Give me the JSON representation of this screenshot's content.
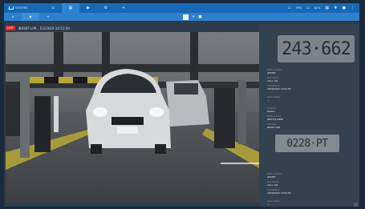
{
  "brand": {
    "name": "VIVOTEK"
  },
  "top_tabs": [
    {
      "icon": "home-icon",
      "glyph": "⌂",
      "active": false
    },
    {
      "icon": "liveview-icon",
      "glyph": "▦",
      "active": true
    },
    {
      "icon": "playback-icon",
      "glyph": "▶",
      "active": false
    },
    {
      "icon": "settings-icon",
      "glyph": "⚙",
      "active": false
    },
    {
      "icon": "add-icon",
      "glyph": "+",
      "active": false
    }
  ],
  "status": {
    "cpu": "39%",
    "mem": "62%"
  },
  "camera": {
    "live_label": "LIVE",
    "name": "IB9387-LPR",
    "datetime": "5/2/2019 10:51:59"
  },
  "panel": {
    "plate_big": "243·662",
    "plate_small": "0228·PT",
    "entries1": [
      {
        "label": "Plate number",
        "value": "243662"
      },
      {
        "label": "List name",
        "value": "not in list"
      },
      {
        "label": "Timestamp",
        "value": "2019/05/02 10:51:55"
      },
      {
        "label": "Lane name",
        "value": "—"
      },
      {
        "label": "Country",
        "value": "Taiwan"
      },
      {
        "label": "Plate source",
        "value": "IP8371E-ANPR"
      },
      {
        "label": "Camera",
        "value": "IB9387-LPR"
      }
    ],
    "entries2": [
      {
        "label": "Plate number",
        "value": "0228PT"
      },
      {
        "label": "List name",
        "value": "not in list"
      },
      {
        "label": "Timestamp",
        "value": "2019/05/02 10:51:54"
      },
      {
        "label": "Lane name",
        "value": "—"
      }
    ]
  },
  "colors": {
    "topbar": "#1769b5",
    "subbar": "#2f80cc",
    "live": "#d62c2c",
    "panel": "#34414f"
  }
}
